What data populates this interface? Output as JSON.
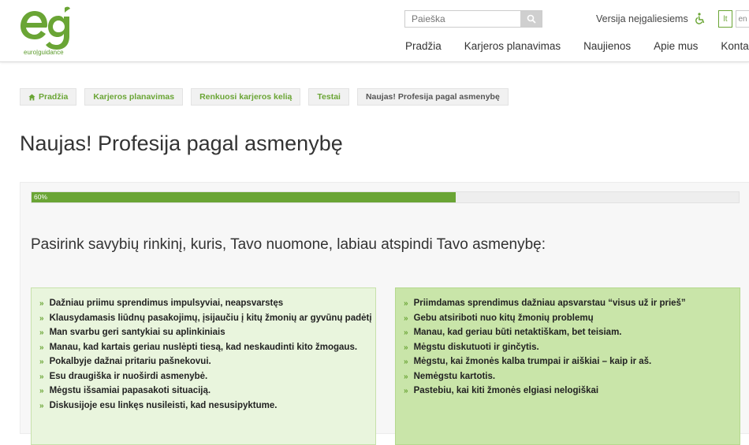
{
  "header": {
    "logo_text": "euro|guidance",
    "search_placeholder": "Paieška",
    "accessibility_label": "Versija neįgaliesiems",
    "languages": [
      "lt",
      "en"
    ],
    "nav": [
      "Pradžia",
      "Karjeros planavimas",
      "Naujienos",
      "Apie mus",
      "Kontaktai"
    ]
  },
  "breadcrumbs": [
    "Pradžia",
    "Karjeros planavimas",
    "Renkuosi karjeros kelią",
    "Testai",
    "Naujas! Profesija pagal asmenybę"
  ],
  "page_title": "Naujas! Profesija pagal asmenybę",
  "quiz": {
    "progress": 0.6,
    "progress_label": "60%",
    "question": "Pasirink savybių rinkinį, kuris, Tavo nuomone, labiau atspindi Tavo asmenybę:",
    "option_a": [
      "Dažniau priimu sprendimus impulsyviai, neapsvarstęs",
      "Klausydamasis liūdnų pasakojimų, įsijaučiu į kitų žmonių ar gyvūnų padėtį",
      "Man svarbu geri santykiai su aplinkiniais",
      "Manau, kad kartais geriau nuslėpti tiesą, kad neskaudinti kito žmogaus.",
      "Pokalbyje dažnai pritariu pašnekovui.",
      "Esu draugiška ir nuoširdi asmenybė.",
      "Mėgstu išsamiai papasakoti situaciją.",
      "Diskusijoje esu linkęs nusileisti, kad nesusipyktume."
    ],
    "option_b": [
      "Priimdamas sprendimus dažniau apsvarstau “visus už ir prieš”",
      "Gebu atsiriboti nuo kitų žmonių problemų",
      "Manau, kad geriau būti netaktiškam, bet teisiam.",
      "Mėgstu diskutuoti ir ginčytis.",
      "Mėgstu, kai žmonės kalba trumpai ir aiškiai – kaip ir aš.",
      "Nemėgstu kartotis.",
      "Pastebiu, kai kiti žmonės elgiasi nelogiškai"
    ]
  },
  "colors": {
    "brand_green": "#6aa535",
    "option_a_bg": "#e9f5dd",
    "option_b_bg": "#c9e5a9"
  }
}
